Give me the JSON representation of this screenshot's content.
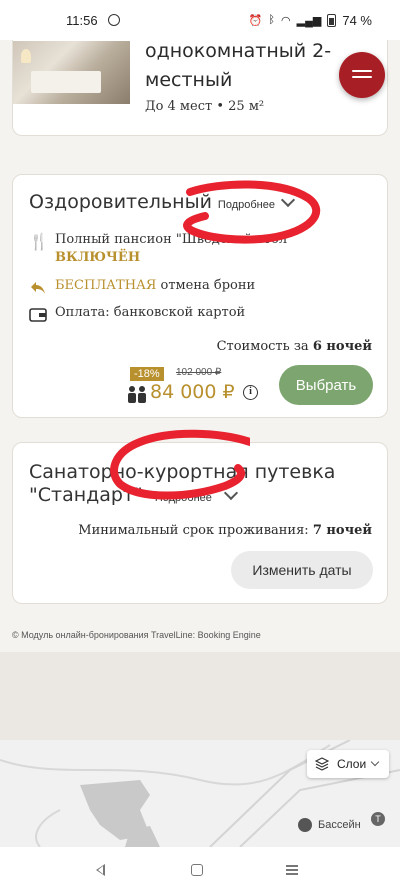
{
  "status_bar": {
    "time": "11:56",
    "battery": "74 %"
  },
  "room": {
    "title": "однокомнатный 2-местный",
    "meta": "До 4 мест • 25 м²"
  },
  "tariff1": {
    "name": "Оздоровительный",
    "more_label": "Подробнее",
    "meal_text": "Полный пансион \"Шведский стол\"",
    "meal_included": "ВКЛЮЧЁН",
    "cancel_free": "БЕСПЛАТНАЯ",
    "cancel_rest": " отмена брони",
    "payment": "Оплата: банковской картой",
    "cost_label_prefix": "Стоимость за ",
    "cost_label_nights": "6 ночей",
    "discount": "-18%",
    "old_price": "102 000 ₽",
    "new_price": "84 000 ₽",
    "select_label": "Выбрать"
  },
  "tariff2": {
    "name": "Санаторно-курортная путевка \"Стандарт\"",
    "more_label": "Подробнее",
    "min_stay_prefix": "Минимальный срок проживания: ",
    "min_stay_nights": "7 ночей",
    "change_dates_label": "Изменить даты"
  },
  "footer": {
    "text": "© Модуль онлайн-бронирования TravelLine: Booking Engine"
  },
  "map": {
    "layers_label": "Слои",
    "pool_label": "Бассейн"
  },
  "colors": {
    "accent_gold": "#b8902e",
    "select_green": "#7da56f",
    "fab_red": "#a81e25",
    "scribble_red": "#e8232f"
  }
}
